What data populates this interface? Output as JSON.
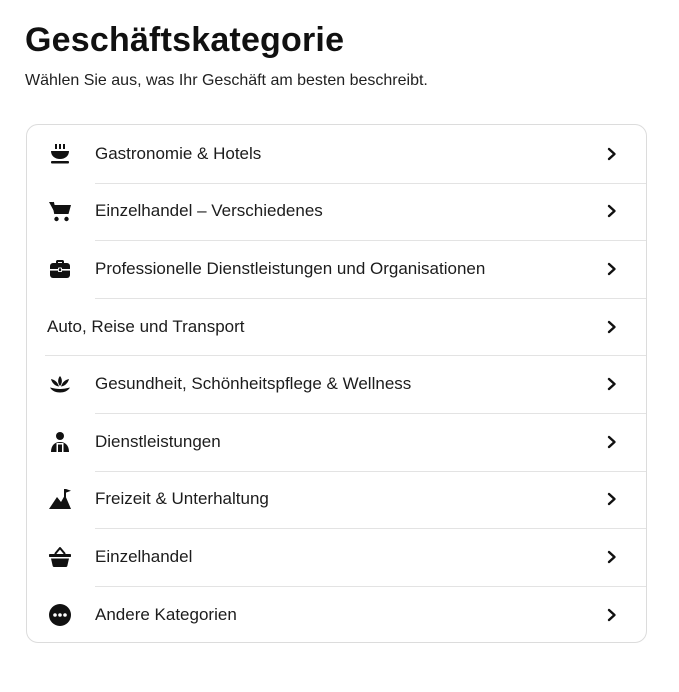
{
  "header": {
    "title": "Geschäftskategorie",
    "subtitle": "Wählen Sie aus, was Ihr Geschäft am besten beschreibt."
  },
  "categories": [
    {
      "label": "Gastronomie & Hotels",
      "icon": "food-bowl-icon"
    },
    {
      "label": "Einzelhandel – Verschiedenes",
      "icon": "shopping-cart-icon"
    },
    {
      "label": "Professionelle Dienstleistungen und Organisationen",
      "icon": "briefcase-icon"
    },
    {
      "label": "Auto, Reise und Transport",
      "icon": ""
    },
    {
      "label": "Gesundheit, Schönheitspflege & Wellness",
      "icon": "lotus-icon"
    },
    {
      "label": "Dienstleistungen",
      "icon": "person-icon"
    },
    {
      "label": "Freizeit & Unterhaltung",
      "icon": "mountain-flag-icon"
    },
    {
      "label": "Einzelhandel",
      "icon": "basket-icon"
    },
    {
      "label": "Andere Kategorien",
      "icon": "more-dots-icon"
    }
  ],
  "colors": {
    "text": "#1a1a1a",
    "divider": "#e3e3e3",
    "border": "#dcdcdc",
    "icon": "#111111"
  }
}
